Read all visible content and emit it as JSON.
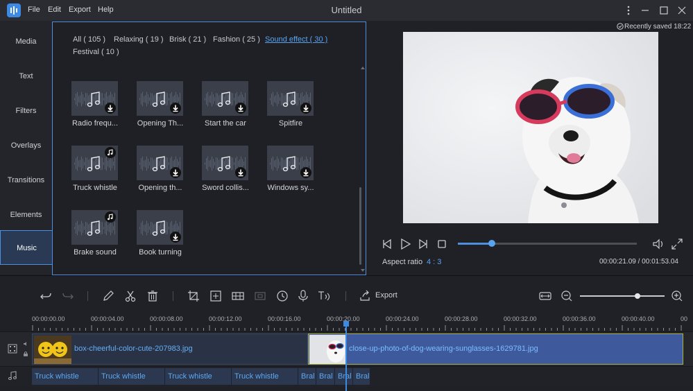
{
  "window": {
    "title": "Untitled",
    "menu": [
      "File",
      "Edit",
      "Export",
      "Help"
    ]
  },
  "rail": {
    "items": [
      "Media",
      "Text",
      "Filters",
      "Overlays",
      "Transitions",
      "Elements",
      "Music"
    ],
    "active": "Music"
  },
  "filters": {
    "tabs": [
      "All ( 105 )",
      "Relaxing ( 19 )",
      "Brisk ( 21 )",
      "Fashion ( 25 )",
      "Sound effect ( 30 )",
      "Festival ( 10 )"
    ],
    "active": "Sound effect ( 30 )"
  },
  "music_items": [
    {
      "name": "Radio frequ...",
      "state": "download-icon"
    },
    {
      "name": "Opening Th...",
      "state": "download-icon"
    },
    {
      "name": "Start the car",
      "state": "download-icon"
    },
    {
      "name": "Spitfire",
      "state": "download-icon"
    },
    {
      "name": "Truck whistle",
      "state": "music-note-icon"
    },
    {
      "name": "Opening th...",
      "state": "download-icon"
    },
    {
      "name": "Sword collis...",
      "state": "download-icon"
    },
    {
      "name": "Windows sy...",
      "state": "download-icon"
    },
    {
      "name": "Brake sound",
      "state": "music-note-icon"
    },
    {
      "name": "Book turning",
      "state": "download-icon"
    }
  ],
  "preview": {
    "saved": "Recently saved 18:22",
    "aspect_label": "Aspect ratio",
    "aspect_value": "4 : 3",
    "time": "00:00:21.09 / 00:01:53.04",
    "progress": 0.19
  },
  "toolbar": {
    "export_label": "Export",
    "zoom": 0.68
  },
  "ruler": {
    "labels": [
      "00:00:00.00",
      "00:00:04.00",
      "00:00:08.00",
      "00:00:12.00",
      "00:00:16.00",
      "00:00:20.00",
      "00:00:24.00",
      "00:00:28.00",
      "00:00:32.00",
      "00:00:36.00",
      "00:00:40.00",
      "00"
    ]
  },
  "timeline": {
    "video_clips": [
      "box-cheerful-color-cute-207983.jpg",
      "close-up-photo-of-dog-wearing-sunglasses-1629781.jpg"
    ],
    "audio_clips": [
      "Truck whistle",
      "Truck whistle",
      "Truck whistle",
      "Truck whistle",
      "Bral",
      "Bral",
      "Bral",
      "Bral"
    ]
  },
  "colors": {
    "accent": "#4f8fe0",
    "clip_blue": "#3f5a9c",
    "playhead": "#3d8ae5"
  }
}
